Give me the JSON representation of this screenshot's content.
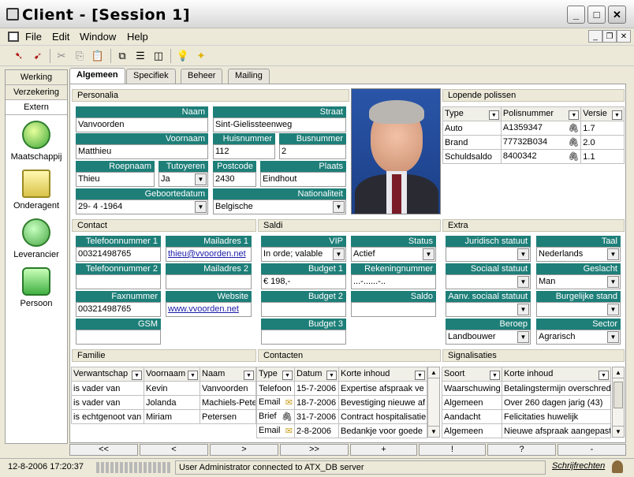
{
  "window": {
    "title": "Client - [Session 1]"
  },
  "menu": [
    "File",
    "Edit",
    "Window",
    "Help"
  ],
  "left_tabs": [
    "Werking",
    "Verzekering",
    "Extern"
  ],
  "nav_items": [
    "Maatschappij",
    "Onderagent",
    "Leverancier",
    "Persoon"
  ],
  "tabs": [
    "Algemeen",
    "Specifiek",
    "Beheer",
    "Mailing"
  ],
  "sections": {
    "personalia": "Personalia",
    "polissen": "Lopende polissen",
    "contact": "Contact",
    "saldi": "Saldi",
    "extra": "Extra",
    "familie": "Familie",
    "contacten": "Contacten",
    "signalisaties": "Signalisaties"
  },
  "personalia": {
    "naam_label": "Naam",
    "naam": "Vanvoorden",
    "straat_label": "Straat",
    "straat": "Sint-Gielissteenweg",
    "voornaam_label": "Voornaam",
    "voornaam": "Matthieu",
    "huisnummer_label": "Huisnummer",
    "huisnummer": "112",
    "busnummer_label": "Busnummer",
    "busnummer": "2",
    "roepnaam_label": "Roepnaam",
    "roepnaam": "Thieu",
    "tutoyeren_label": "Tutoyeren",
    "tutoyeren": "Ja",
    "postcode_label": "Postcode",
    "postcode": "2430",
    "plaats_label": "Plaats",
    "plaats": "Eindhout",
    "geboortedatum_label": "Geboortedatum",
    "geboortedatum": "29- 4 -1964",
    "nationaliteit_label": "Nationaliteit",
    "nationaliteit": "Belgische"
  },
  "polissen": {
    "headers": [
      "Type",
      "Polisnummer",
      "Versie"
    ],
    "rows": [
      [
        "Auto",
        "A1359347",
        "1.7"
      ],
      [
        "Brand",
        "77732B034",
        "2.0"
      ],
      [
        "Schuldsaldo",
        "8400342",
        "1.1"
      ]
    ]
  },
  "contact": {
    "tel1_label": "Telefoonnummer 1",
    "tel1": "00321498765",
    "mail1_label": "Mailadres 1",
    "mail1": "thieu@vvoorden.net",
    "tel2_label": "Telefoonnummer 2",
    "tel2": "",
    "mail2_label": "Mailadres 2",
    "mail2": "",
    "fax_label": "Faxnummer",
    "fax": "00321498765",
    "website_label": "Website",
    "website": "www.vvoorden.net",
    "gsm_label": "GSM",
    "gsm": ""
  },
  "saldi": {
    "vip_label": "VIP",
    "vip": "In orde; valable",
    "status_label": "Status",
    "status": "Actief",
    "budget1_label": "Budget 1",
    "budget1": "€ 198,-",
    "rekening_label": "Rekeningnummer",
    "rekening": "...-......-..",
    "budget2_label": "Budget 2",
    "saldo_label": "Saldo",
    "budget3_label": "Budget 3"
  },
  "extra": {
    "juridisch_label": "Juridisch statuut",
    "taal_label": "Taal",
    "taal": "Nederlands",
    "sociaal_label": "Sociaal statuut",
    "geslacht_label": "Geslacht",
    "geslacht": "Man",
    "aanv_label": "Aanv. sociaal statuut",
    "burgerlijk_label": "Burgelijke stand",
    "beroep_label": "Beroep",
    "beroep": "Landbouwer",
    "sector_label": "Sector",
    "sector": "Agrarisch"
  },
  "familie": {
    "headers": [
      "Verwantschap",
      "Voornaam",
      "Naam"
    ],
    "rows": [
      [
        "is vader van",
        "Kevin",
        "Vanvoorden"
      ],
      [
        "is vader van",
        "Jolanda",
        "Machiels-Pete"
      ],
      [
        "is echtgenoot van",
        "Miriam",
        "Petersen"
      ]
    ]
  },
  "contacten": {
    "headers": [
      "Type",
      "Datum",
      "Korte inhoud"
    ],
    "rows": [
      [
        "Telefoon",
        "15-7-2006",
        "Expertise afspraak ve"
      ],
      [
        "Email",
        "18-7-2006",
        "Bevestiging nieuwe af"
      ],
      [
        "Brief",
        "31-7-2006",
        "Contract hospitalisatie"
      ],
      [
        "Email",
        "2-8-2006",
        "Bedankje voor goede"
      ]
    ]
  },
  "signalisaties": {
    "headers": [
      "Soort",
      "Korte inhoud"
    ],
    "rows": [
      [
        "Waarschuwing",
        "Betalingstermijn overschred"
      ],
      [
        "Algemeen",
        "Over 260 dagen jarig (43)"
      ],
      [
        "Aandacht",
        "Felicitaties huwelijk"
      ],
      [
        "Algemeen",
        "Nieuwe afspraak aangepast"
      ]
    ]
  },
  "nav_buttons": [
    "<<",
    "<",
    ">",
    ">>",
    "+",
    "!",
    "?",
    "-"
  ],
  "status": {
    "datetime": "12-8-2006 17:20:37",
    "message": "User Administrator connected to ATX_DB server",
    "user": "Schrijfrechten"
  }
}
